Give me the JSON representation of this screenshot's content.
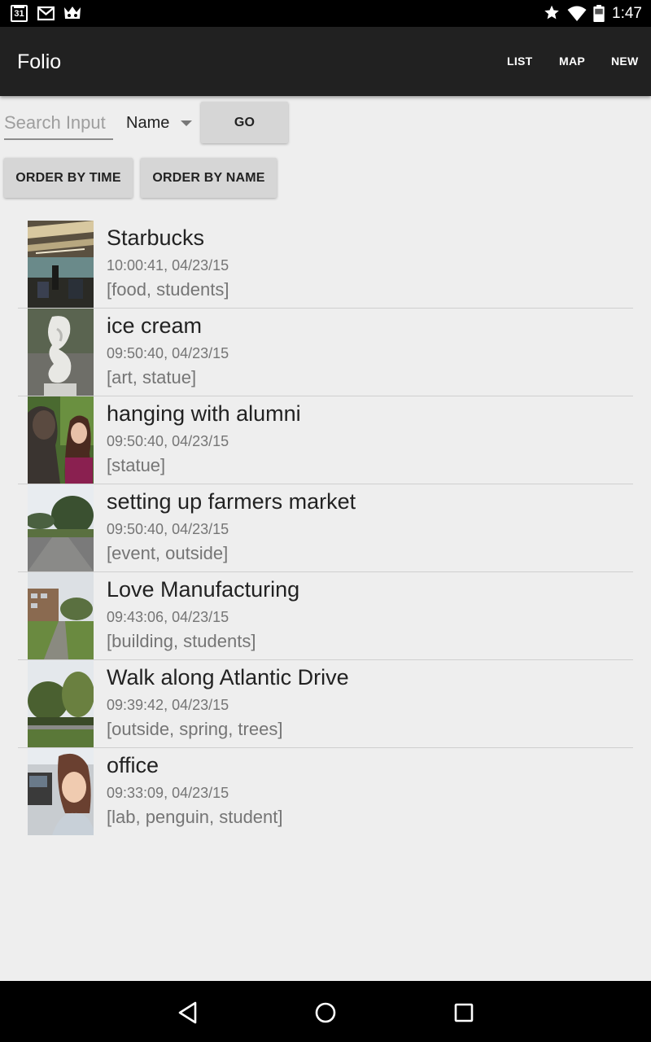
{
  "status_bar": {
    "calendar_day": "31",
    "time": "1:47",
    "icons": [
      "calendar-icon",
      "gmail-icon",
      "crown-icon",
      "star-icon",
      "wifi-icon",
      "battery-icon"
    ]
  },
  "app_bar": {
    "title": "Folio",
    "actions": {
      "list": "LIST",
      "map": "MAP",
      "new": "NEW"
    }
  },
  "search": {
    "placeholder": "Search Input",
    "value": "",
    "field_selected": "Name",
    "go_label": "GO"
  },
  "order_buttons": {
    "time": "ORDER BY TIME",
    "name": "ORDER BY NAME"
  },
  "items": [
    {
      "title": "Starbucks",
      "time": "10:00:41, 04/23/15",
      "tags": "[food, students]",
      "thumb": "cafe-interior"
    },
    {
      "title": "ice cream",
      "time": "09:50:40, 04/23/15",
      "tags": "[art, statue]",
      "thumb": "white-sculpture"
    },
    {
      "title": "hanging with alumni",
      "time": "09:50:40, 04/23/15",
      "tags": "[statue]",
      "thumb": "selfie-with-statue"
    },
    {
      "title": "setting up farmers market",
      "time": "09:50:40, 04/23/15",
      "tags": "[event, outside]",
      "thumb": "parking-lot-trees"
    },
    {
      "title": "Love Manufacturing",
      "time": "09:43:06, 04/23/15",
      "tags": "[building, students]",
      "thumb": "campus-building-path"
    },
    {
      "title": "Walk along Atlantic Drive",
      "time": "09:39:42, 04/23/15",
      "tags": "[outside, spring, trees]",
      "thumb": "spring-trees-road"
    },
    {
      "title": "office",
      "time": "09:33:09, 04/23/15",
      "tags": "[lab, penguin, student]",
      "thumb": "office-selfie"
    }
  ],
  "nav_bar": {
    "icons": [
      "back-icon",
      "home-icon",
      "recents-icon"
    ]
  },
  "colors": {
    "status_bar": "#000000",
    "app_bar": "#212121",
    "background": "#eeeeee",
    "button": "#d6d6d6",
    "divider": "#cfcfcf"
  }
}
